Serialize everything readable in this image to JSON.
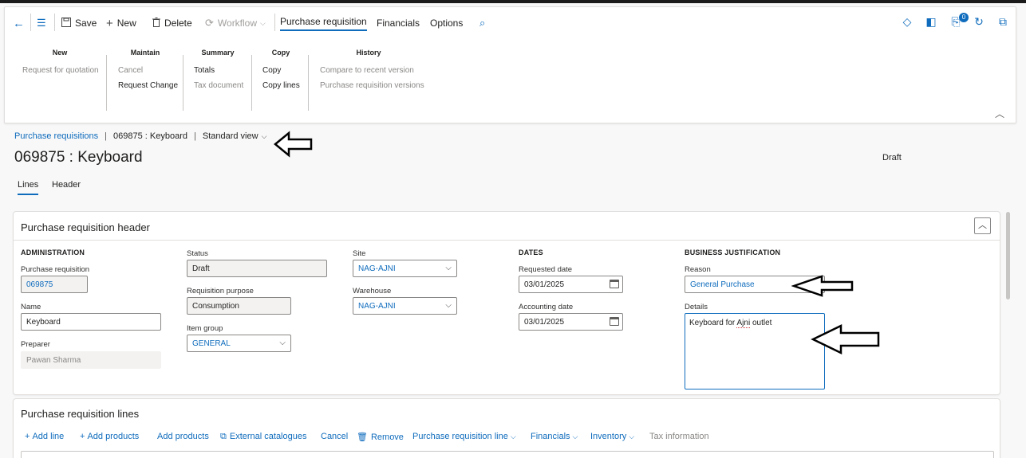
{
  "actionbar": {
    "save": "Save",
    "new": "New",
    "delete": "Delete",
    "workflow": "Workflow",
    "tabs": [
      "Purchase requisition",
      "Financials",
      "Options"
    ],
    "notification_count": "0"
  },
  "ribbon": {
    "groups": [
      {
        "title": "New",
        "items": [
          "Request for quotation"
        ]
      },
      {
        "title": "Maintain",
        "items": [
          "Cancel",
          "Request Change"
        ]
      },
      {
        "title": "Summary",
        "items": [
          "Totals",
          "Tax document"
        ]
      },
      {
        "title": "Copy",
        "items": [
          "Copy",
          "Copy lines"
        ]
      },
      {
        "title": "History",
        "items": [
          "Compare to recent version",
          "Purchase requisition versions"
        ]
      }
    ]
  },
  "breadcrumb": {
    "link": "Purchase requisitions",
    "current": "069875 : Keyboard",
    "view": "Standard view"
  },
  "page": {
    "title": "069875 : Keyboard",
    "status": "Draft",
    "subtabs": [
      "Lines",
      "Header"
    ]
  },
  "header_card": {
    "title": "Purchase requisition header",
    "administration": {
      "title": "ADMINISTRATION",
      "purchase_requisition_label": "Purchase requisition",
      "purchase_requisition_value": "069875",
      "name_label": "Name",
      "name_value": "Keyboard",
      "preparer_label": "Preparer",
      "preparer_value": "Pawan Sharma"
    },
    "status_col": {
      "status_label": "Status",
      "status_value": "Draft",
      "purpose_label": "Requisition purpose",
      "purpose_value": "Consumption",
      "item_group_label": "Item group",
      "item_group_value": "GENERAL"
    },
    "site_col": {
      "site_label": "Site",
      "site_value": "NAG-AJNI",
      "warehouse_label": "Warehouse",
      "warehouse_value": "NAG-AJNI"
    },
    "dates": {
      "title": "DATES",
      "requested_label": "Requested date",
      "requested_value": "03/01/2025",
      "accounting_label": "Accounting date",
      "accounting_value": "03/01/2025"
    },
    "justification": {
      "title": "BUSINESS JUSTIFICATION",
      "reason_label": "Reason",
      "reason_value": "General Purchase",
      "details_label": "Details",
      "details_prefix": "Keyboard for ",
      "details_misspelled": "Ajni",
      "details_suffix": " outlet"
    }
  },
  "lines_card": {
    "title": "Purchase requisition lines",
    "toolbar": [
      "Add line",
      "Add products",
      "Add products",
      "External catalogues",
      "Cancel",
      "Remove",
      "Purchase requisition line",
      "Financials",
      "Inventory",
      "Tax information"
    ]
  },
  "colors": {
    "accent": "#0f6cbd",
    "disabled_text": "#a19f9d"
  }
}
